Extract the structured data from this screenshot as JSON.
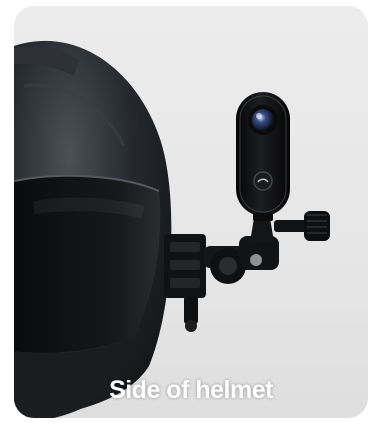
{
  "caption": "Side of helmet",
  "icons": [
    "helmet",
    "action-camera",
    "mount-arm",
    "adhesive-clamp"
  ],
  "colors": {
    "background": "#e8e8e8",
    "helmet": "#1c1f22",
    "camera": "#0e0e0f",
    "caption_text": "#ffffff"
  }
}
